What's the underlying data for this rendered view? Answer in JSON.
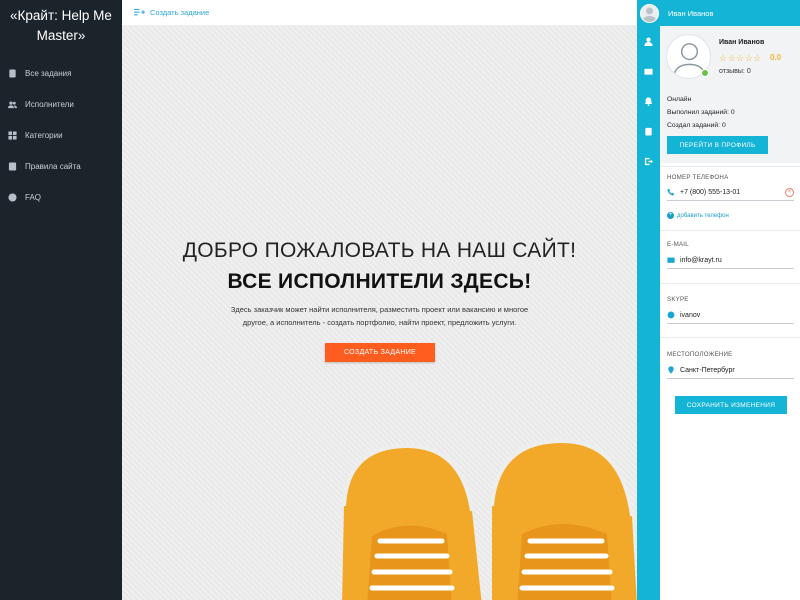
{
  "sidebar": {
    "brand": "«Крайт: Help Me Master»",
    "items": [
      {
        "label": "Все задания",
        "icon": "tasks-icon"
      },
      {
        "label": "Исполнители",
        "icon": "users-icon"
      },
      {
        "label": "Категории",
        "icon": "categories-icon"
      },
      {
        "label": "Правила сайта",
        "icon": "rules-icon"
      },
      {
        "label": "FAQ",
        "icon": "help-icon"
      }
    ]
  },
  "topbar": {
    "create_label": "Создать задание",
    "icon": "add-list-icon"
  },
  "hero": {
    "title_line1": "ДОБРО ПОЖАЛОВАТЬ НА НАШ САЙТ!",
    "title_line2": "ВСЕ ИСПОЛНИТЕЛИ ЗДЕСЬ!",
    "description": "Здесь заказчик может найти исполнителя, разместить проект или вакансию и многое другое, а исполнитель - создать портфолио, найти проект, предложить услуги.",
    "cta_label": "СОЗДАТЬ ЗАДАНИЕ",
    "image": "orange-sneakers",
    "colors": {
      "cta": "#ff5d1f",
      "background": "#ececec"
    }
  },
  "rail": {
    "icons": [
      "user-icon",
      "mail-icon",
      "bell-icon",
      "clipboard-icon",
      "logout-icon"
    ]
  },
  "profile": {
    "header_name": "Иван Иванов",
    "name": "Иван Иванов",
    "stars": "☆☆☆☆☆",
    "rating": "0.0",
    "reviews": "отзывы: 0",
    "status": "Онлайн",
    "completed": "Выполнил заданий: 0",
    "created": "Создал заданий: 0",
    "profile_button": "ПЕРЕЙТИ В ПРОФИЛЬ",
    "phone_label": "НОМЕР ТЕЛЕФОНА",
    "phone_value": "+7 (800) 555-13-01",
    "add_phone": "добавить телефон",
    "email_label": "E-MAIL",
    "email_value": "info@krayt.ru",
    "skype_label": "SKYPE",
    "skype_value": "ivanov",
    "location_label": "МЕСТОПОЛОЖЕНИЕ",
    "location_value": "Санкт-Петербург",
    "save_button": "СОХРАНИТЬ ИЗМЕНЕНИЯ",
    "colors": {
      "accent": "#14b4d6",
      "online": "#6cc04a",
      "stars": "#f2b53c"
    }
  }
}
